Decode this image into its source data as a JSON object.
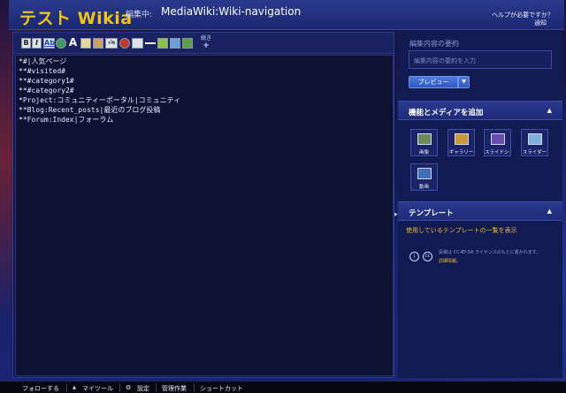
{
  "header": {
    "wiki_title": "テスト Wikia",
    "editing_prefix": "編集中:",
    "page_name": "MediaWiki:Wiki-navigation",
    "help_link": "ヘルプが必要ですか？",
    "notify_link": "通知"
  },
  "toolbar": {
    "buttons": [
      "bold-icon",
      "italic-icon",
      "internal-link-icon",
      "external-link-icon",
      "headline-icon",
      "image-icon",
      "media-icon",
      "math-icon",
      "nowiki-icon",
      "signature-icon",
      "horizontal-line-icon",
      "gallery-icon",
      "table-icon",
      "template-icon"
    ],
    "bold_label": "B",
    "italic_label": "I",
    "link_label": "Ab",
    "headline_label": "A",
    "math_label": "√n",
    "more_label": "続き",
    "more_plus": "+"
  },
  "editor": {
    "lines": [
      "*#|人気ページ",
      "**#visited#",
      "**#category1#",
      "**#category2#",
      "*Project:コミュニティーポータル|コミュニティ",
      "**Blog:Recent_posts|最近のブログ投稿",
      "**Forum:Index|フォーラム"
    ]
  },
  "summary": {
    "label": "編集内容の要約",
    "placeholder": "編集内容の要約を入力",
    "preview_button": "プレビュー",
    "preview_arrow": "▼"
  },
  "media_section": {
    "title": "機能とメディアを追加",
    "collapse": "▲",
    "items": [
      {
        "label": "画像",
        "icon": "image-icon"
      },
      {
        "label": "ギャラリー",
        "icon": "gallery-icon"
      },
      {
        "label": "スライドショー",
        "icon": "slideshow-icon"
      },
      {
        "label": "スライダー",
        "icon": "slider-icon"
      },
      {
        "label": "動画",
        "icon": "video-icon"
      }
    ]
  },
  "template_section": {
    "title": "テンプレート",
    "collapse": "▲",
    "link": "使用しているテンプレートの一覧を表示"
  },
  "license": {
    "text": "投稿は CC-BY-SA ライセンスのもとに置かれます。",
    "detail_link": "詳細情報。",
    "icon1": "i",
    "icon2": "cc"
  },
  "footer": {
    "follow": "フォローする",
    "my_tools_arrow": "▲",
    "my_tools": "マイツール",
    "settings": "設定",
    "admin": "管理作業",
    "shortcuts": "ショートカット"
  },
  "colors": {
    "wiki_title": "#f0c419",
    "link": "#e6b93a",
    "button": "#3a68d6"
  }
}
